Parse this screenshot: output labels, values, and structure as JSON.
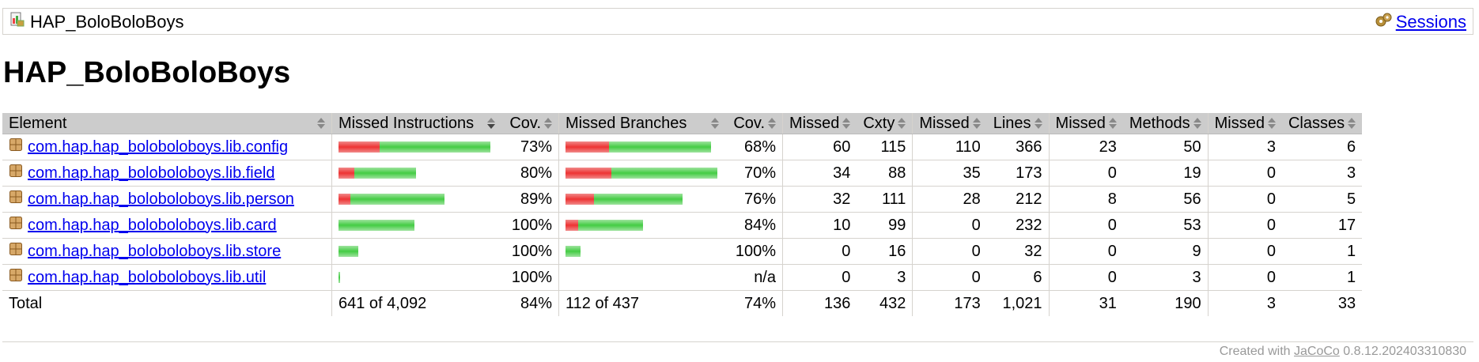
{
  "breadcrumb": {
    "report_name": "HAP_BoloBoloBoys",
    "sessions_label": "Sessions"
  },
  "page": {
    "title": "HAP_BoloBoloBoys"
  },
  "table": {
    "headers": {
      "element": "Element",
      "missed_instructions": "Missed Instructions",
      "cov1": "Cov.",
      "missed_branches": "Missed Branches",
      "cov2": "Cov.",
      "missed_cxty": "Missed",
      "cxty": "Cxty",
      "missed_lines": "Missed",
      "lines": "Lines",
      "missed_methods": "Missed",
      "methods": "Methods",
      "missed_classes": "Missed",
      "classes": "Classes"
    },
    "rows": [
      {
        "name": "com.hap.hap_boloboloboys.lib.config",
        "instr_missed_frac": 0.73,
        "instr_total_frac": 1.0,
        "instr_cov": "73%",
        "branch_missed_frac": 0.3,
        "branch_total_frac": 0.96,
        "branch_cov": "68%",
        "missed_cxty": "60",
        "cxty": "115",
        "missed_lines": "110",
        "lines": "366",
        "missed_methods": "23",
        "methods": "50",
        "missed_classes": "3",
        "classes": "6"
      },
      {
        "name": "com.hap.hap_boloboloboys.lib.field",
        "instr_missed_frac": 0.8,
        "instr_total_frac": 0.51,
        "instr_cov": "80%",
        "branch_missed_frac": 0.3,
        "branch_total_frac": 1.0,
        "branch_cov": "70%",
        "missed_cxty": "34",
        "cxty": "88",
        "missed_lines": "35",
        "lines": "173",
        "missed_methods": "0",
        "methods": "19",
        "missed_classes": "0",
        "classes": "3"
      },
      {
        "name": "com.hap.hap_boloboloboys.lib.person",
        "instr_missed_frac": 0.89,
        "instr_total_frac": 0.7,
        "instr_cov": "89%",
        "branch_missed_frac": 0.24,
        "branch_total_frac": 0.77,
        "branch_cov": "76%",
        "missed_cxty": "32",
        "cxty": "111",
        "missed_lines": "28",
        "lines": "212",
        "missed_methods": "8",
        "methods": "56",
        "missed_classes": "0",
        "classes": "5"
      },
      {
        "name": "com.hap.hap_boloboloboys.lib.card",
        "instr_missed_frac": 1.0,
        "instr_total_frac": 0.5,
        "instr_cov": "100%",
        "branch_missed_frac": 0.16,
        "branch_total_frac": 0.51,
        "branch_cov": "84%",
        "missed_cxty": "10",
        "cxty": "99",
        "missed_lines": "0",
        "lines": "232",
        "missed_methods": "0",
        "methods": "53",
        "missed_classes": "0",
        "classes": "17"
      },
      {
        "name": "com.hap.hap_boloboloboys.lib.store",
        "instr_missed_frac": 1.0,
        "instr_total_frac": 0.13,
        "instr_cov": "100%",
        "branch_missed_frac": 0.0,
        "branch_total_frac": 0.1,
        "branch_cov": "100%",
        "missed_cxty": "0",
        "cxty": "16",
        "missed_lines": "0",
        "lines": "32",
        "missed_methods": "0",
        "methods": "9",
        "missed_classes": "0",
        "classes": "1"
      },
      {
        "name": "com.hap.hap_boloboloboys.lib.util",
        "instr_missed_frac": 1.0,
        "instr_total_frac": 0.01,
        "instr_cov": "100%",
        "branch_missed_frac": 0.0,
        "branch_total_frac": 0.0,
        "branch_cov": "n/a",
        "missed_cxty": "0",
        "cxty": "3",
        "missed_lines": "0",
        "lines": "6",
        "missed_methods": "0",
        "methods": "3",
        "missed_classes": "0",
        "classes": "1"
      }
    ],
    "total": {
      "label": "Total",
      "instructions": "641 of 4,092",
      "instr_cov": "84%",
      "branches": "112 of 437",
      "branch_cov": "74%",
      "missed_cxty": "136",
      "cxty": "432",
      "missed_lines": "173",
      "lines": "1,021",
      "missed_methods": "31",
      "methods": "190",
      "missed_classes": "3",
      "classes": "33"
    }
  },
  "footer": {
    "prefix": "Created with",
    "tool": "JaCoCo",
    "version": "0.8.12.202403310830"
  },
  "colors": {
    "missed": "#e33333",
    "covered": "#44cc44",
    "link": "#0000ee"
  }
}
